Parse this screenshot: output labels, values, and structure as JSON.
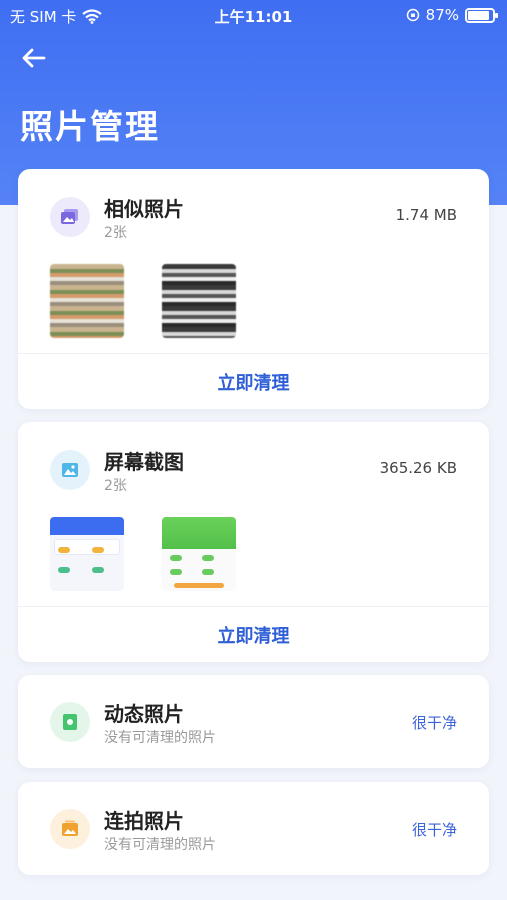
{
  "status_bar": {
    "carrier": "无 SIM 卡",
    "time": "上午11:01",
    "battery_percent": "87%",
    "battery_level": 0.87
  },
  "header": {
    "title": "照片管理"
  },
  "cards": [
    {
      "title": "相似照片",
      "subtitle": "2张",
      "size": "1.74 MB",
      "action": "立即清理",
      "icon": "photos-icon"
    },
    {
      "title": "屏幕截图",
      "subtitle": "2张",
      "size": "365.26 KB",
      "action": "立即清理",
      "icon": "screenshot-icon"
    },
    {
      "title": "动态照片",
      "subtitle": "没有可清理的照片",
      "status": "很干净",
      "icon": "live-photo-icon"
    },
    {
      "title": "连拍照片",
      "subtitle": "没有可清理的照片",
      "status": "很干净",
      "icon": "burst-photo-icon"
    }
  ],
  "colors": {
    "header_blue": "#3f6ef2",
    "action_blue": "#2f5fd6",
    "status_blue": "#3d63d9"
  }
}
